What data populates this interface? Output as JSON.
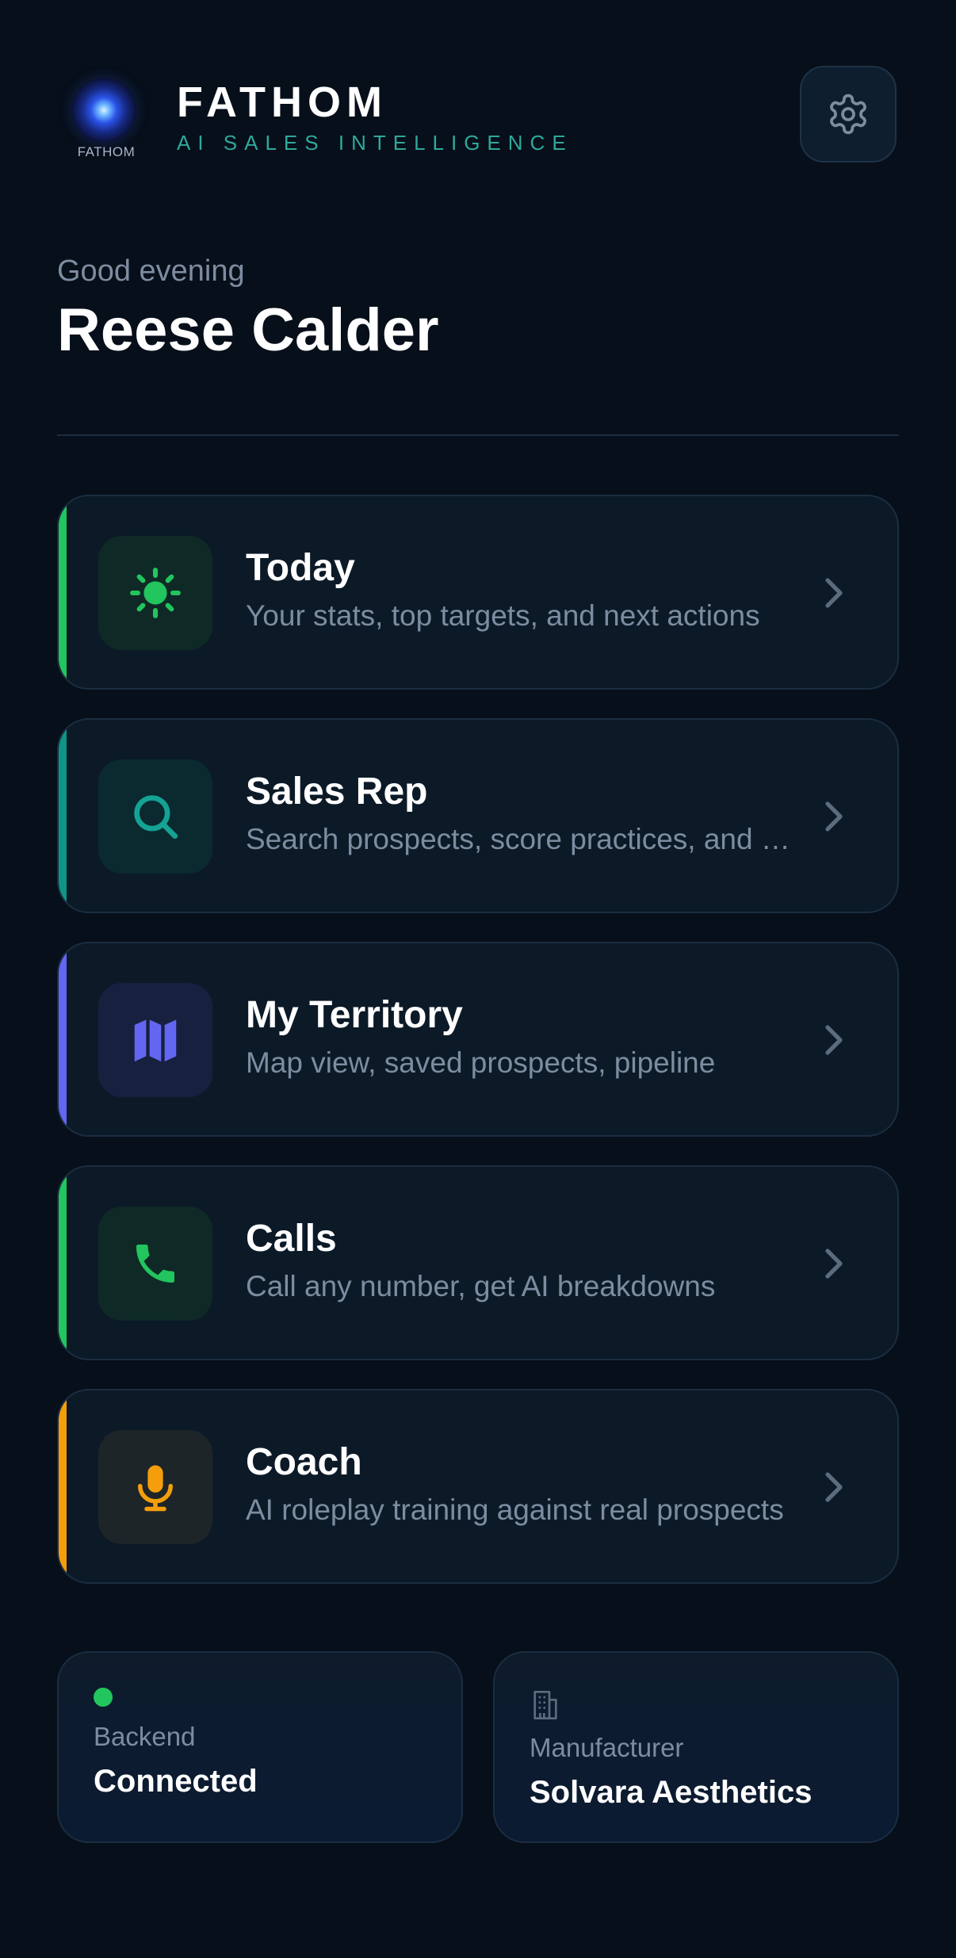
{
  "header": {
    "logo_text": "FATHOM",
    "brand_name": "FATHOM",
    "tagline": "AI SALES INTELLIGENCE",
    "settings_icon": "gear-icon"
  },
  "greeting": {
    "salutation": "Good evening",
    "name": "Reese Calder"
  },
  "menu": [
    {
      "title": "Today",
      "description": "Your stats, top targets, and next actions",
      "icon": "sun-icon",
      "accent": "#22c55e"
    },
    {
      "title": "Sales Rep",
      "description": "Search prospects, score practices, and more",
      "icon": "search-icon",
      "accent": "#0f9488"
    },
    {
      "title": "My Territory",
      "description": "Map view, saved prospects, pipeline",
      "icon": "map-icon",
      "accent": "#6366f1"
    },
    {
      "title": "Calls",
      "description": "Call any number, get AI breakdowns",
      "icon": "phone-icon",
      "accent": "#22c55e"
    },
    {
      "title": "Coach",
      "description": "AI roleplay training against real prospects",
      "icon": "microphone-icon",
      "accent": "#f59e0b"
    }
  ],
  "status": {
    "backend_label": "Backend",
    "backend_value": "Connected",
    "manufacturer_label": "Manufacturer",
    "manufacturer_value": "Solvara Aesthetics"
  },
  "colors": {
    "background": "#060f1a",
    "card": "#0c1a28",
    "tagline": "#2fa89a",
    "connected": "#22c55e"
  }
}
